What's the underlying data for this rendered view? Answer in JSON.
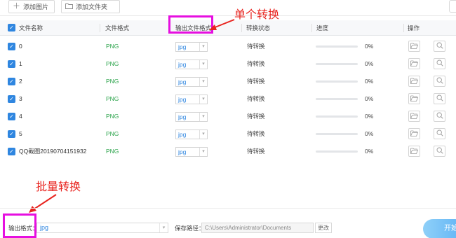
{
  "toolbar": {
    "add_image_label": "添加图片",
    "add_folder_label": "添加文件夹"
  },
  "table": {
    "headers": {
      "name": "文件名称",
      "format": "文件格式",
      "output_format": "输出文件格式",
      "status": "转换状态",
      "progress": "进度",
      "actions": "操作"
    },
    "rows": [
      {
        "name": "0",
        "format": "PNG",
        "output": "jpg",
        "status": "待转换",
        "progress": 0,
        "progress_label": "0%"
      },
      {
        "name": "1",
        "format": "PNG",
        "output": "jpg",
        "status": "待转换",
        "progress": 0,
        "progress_label": "0%"
      },
      {
        "name": "2",
        "format": "PNG",
        "output": "jpg",
        "status": "待转换",
        "progress": 0,
        "progress_label": "0%"
      },
      {
        "name": "3",
        "format": "PNG",
        "output": "jpg",
        "status": "待转换",
        "progress": 0,
        "progress_label": "0%"
      },
      {
        "name": "4",
        "format": "PNG",
        "output": "jpg",
        "status": "待转换",
        "progress": 0,
        "progress_label": "0%"
      },
      {
        "name": "5",
        "format": "PNG",
        "output": "jpg",
        "status": "待转换",
        "progress": 0,
        "progress_label": "0%"
      },
      {
        "name": "QQ截图20190704151932",
        "format": "PNG",
        "output": "jpg",
        "status": "待转换",
        "progress": 0,
        "progress_label": "0%"
      }
    ]
  },
  "annotations": {
    "single": "单个转换",
    "batch": "批量转换"
  },
  "bottom": {
    "output_format_label": "输出格式：",
    "output_format_value": "jpg",
    "save_path_label": "保存路径：",
    "save_path_value": "C:\\Users\\Administrator\\Documents",
    "change_label": "更改",
    "start_label": "开始"
  },
  "colors": {
    "accent": "#2f86e0",
    "format_green": "#2aa34a",
    "highlight_magenta": "#e60fe0",
    "annotation_red": "#e8231e"
  },
  "icons": {
    "add_image": "plus-icon",
    "add_folder": "folder-icon",
    "open_folder": "folder-open-icon",
    "preview": "magnifier-icon"
  }
}
